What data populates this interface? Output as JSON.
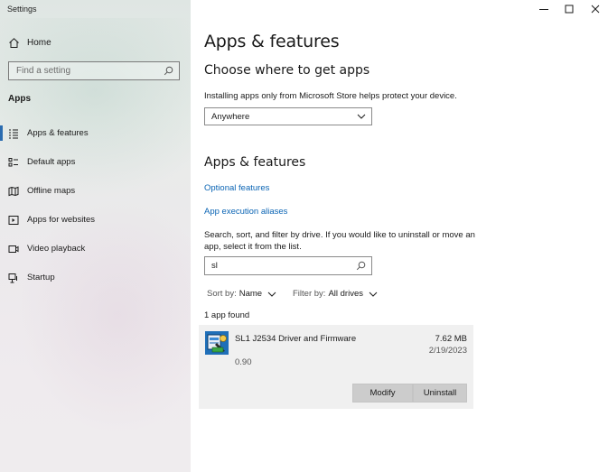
{
  "window": {
    "title": "Settings",
    "controls": [
      "minimize-icon",
      "maximize-icon",
      "close-icon"
    ]
  },
  "sidebar": {
    "home_label": "Home",
    "search_placeholder": "Find a setting",
    "section": "Apps",
    "items": [
      {
        "label": "Apps & features",
        "icon": "apps-list-icon",
        "active": true
      },
      {
        "label": "Default apps",
        "icon": "default-apps-icon",
        "active": false
      },
      {
        "label": "Offline maps",
        "icon": "map-icon",
        "active": false
      },
      {
        "label": "Apps for websites",
        "icon": "web-app-icon",
        "active": false
      },
      {
        "label": "Video playback",
        "icon": "video-icon",
        "active": false
      },
      {
        "label": "Startup",
        "icon": "startup-icon",
        "active": false
      }
    ]
  },
  "main": {
    "title": "Apps & features",
    "source_heading": "Choose where to get apps",
    "source_desc": "Installing apps only from Microsoft Store helps protect your device.",
    "source_value": "Anywhere",
    "features_heading": "Apps & features",
    "link_optional": "Optional features",
    "link_aliases": "App execution aliases",
    "search_desc_line1": "Search, sort, and filter by drive. If you would like to uninstall or move an",
    "search_desc_line2": "app, select it from the list.",
    "search_value": "sl",
    "sort_prefix": "Sort by:",
    "sort_value": "Name",
    "filter_prefix": "Filter by:",
    "filter_value": "All drives",
    "found_text": "1 app found",
    "app": {
      "name": "SL1 J2534 Driver and Firmware",
      "size": "7.62 MB",
      "date": "2/19/2023",
      "version": "0.90",
      "modify_label": "Modify",
      "uninstall_label": "Uninstall"
    }
  },
  "colors": {
    "accent": "#0a64b4",
    "active_bar": "#2b6cb0",
    "card_bg": "#f0f0f0",
    "button_bg": "#cccccc"
  }
}
